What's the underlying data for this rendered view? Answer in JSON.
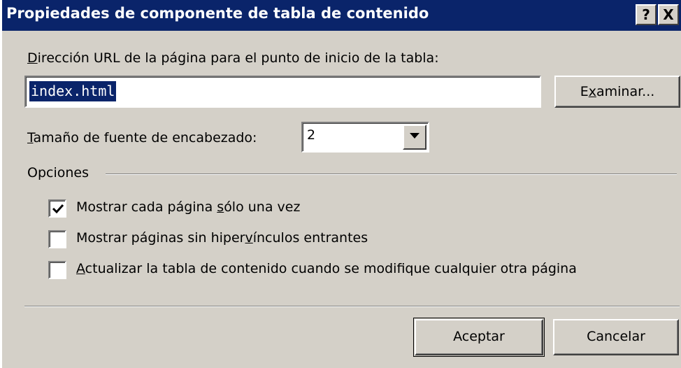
{
  "window": {
    "title": "Propiedades de componente de tabla de contenido",
    "help_glyph": "?",
    "close_glyph": "X"
  },
  "url": {
    "label_prefix": "",
    "label_accel": "D",
    "label_rest": "irección URL de la página para el punto de inicio de la tabla:",
    "value": "index.html",
    "browse_prefix": "E",
    "browse_accel": "x",
    "browse_rest": "aminar..."
  },
  "font_size": {
    "label_accel": "T",
    "label_rest": "amaño de fuente de encabezado:",
    "value": "2"
  },
  "options": {
    "group_label": "Opciones",
    "items": [
      {
        "checked": true,
        "pre": "Mostrar cada página ",
        "accel": "s",
        "post": "ólo una vez"
      },
      {
        "checked": false,
        "pre": "Mostrar páginas sin hiper",
        "accel": "v",
        "post": "ínculos entrantes"
      },
      {
        "checked": false,
        "pre": "",
        "accel": "A",
        "post": "ctualizar la tabla de contenido cuando se modifique cualquier otra página"
      }
    ]
  },
  "buttons": {
    "ok_label": "Aceptar",
    "cancel_label": "Cancelar"
  },
  "colors": {
    "titlebar": "#0a246a",
    "face": "#d4d0c8",
    "selection": "#0a246a"
  },
  "icons": {
    "help": "question-mark-icon",
    "close": "close-icon",
    "dropdown": "triangle-down-icon",
    "check": "checkmark-icon"
  }
}
